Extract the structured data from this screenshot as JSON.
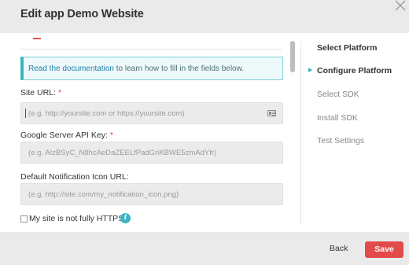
{
  "header": {
    "title": "Edit app Demo Website",
    "close_icon": "close-icon"
  },
  "form": {
    "info_link": "Read the documentation",
    "info_text": " to learn how to fill in the fields below.",
    "site_url": {
      "label": "Site URL:",
      "required": "*",
      "placeholder": "(e.g. http://yoursite.com or https://yoursite.com)",
      "icon": "contact-card-icon"
    },
    "api_key": {
      "label": "Google Server API Key:",
      "required": "*",
      "placeholder": "(e.g. AIzBSyC_N8hcAeDaZEELfPadGnKBWE5zmAdYfr)"
    },
    "icon_url": {
      "label": "Default Notification Icon URL:",
      "placeholder": "(e.g. http://site.com/my_notification_icon.png)"
    },
    "https_checkbox_label": "My site is not fully HTTPS",
    "info_icon_glyph": "i"
  },
  "steps": [
    {
      "label": "Select Platform",
      "state": "done"
    },
    {
      "label": "Configure Platform",
      "state": "active"
    },
    {
      "label": "Select SDK",
      "state": "pending"
    },
    {
      "label": "Install SDK",
      "state": "pending"
    },
    {
      "label": "Test Settings",
      "state": "pending"
    }
  ],
  "footer": {
    "back_label": "Back",
    "save_label": "Save"
  },
  "colors": {
    "accent": "#39b6c1",
    "danger": "#e34b4b",
    "header_bg": "#eaeaea"
  }
}
